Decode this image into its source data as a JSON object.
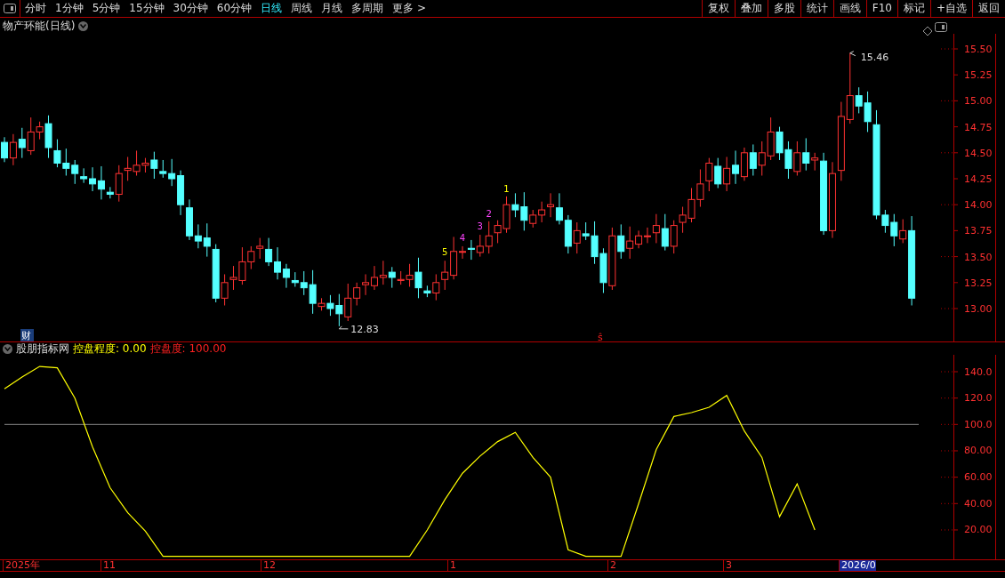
{
  "toolbar": {
    "periods": [
      {
        "label": "分时",
        "selected": false
      },
      {
        "label": "1分钟",
        "selected": false
      },
      {
        "label": "5分钟",
        "selected": false
      },
      {
        "label": "15分钟",
        "selected": false
      },
      {
        "label": "30分钟",
        "selected": false
      },
      {
        "label": "60分钟",
        "selected": false
      },
      {
        "label": "日线",
        "selected": true
      },
      {
        "label": "周线",
        "selected": false
      },
      {
        "label": "月线",
        "selected": false
      },
      {
        "label": "多周期",
        "selected": false
      }
    ],
    "more": "更多 >",
    "buttons": [
      "复权",
      "叠加",
      "多股",
      "统计",
      "画线",
      "F10",
      "标记",
      "+自选",
      "返回"
    ]
  },
  "price_panel": {
    "title": "物产环能(日线)",
    "axis_labels": [
      "15.50",
      "15.25",
      "15.00",
      "14.75",
      "14.50",
      "14.25",
      "14.00",
      "13.75",
      "13.50",
      "13.25",
      "13.00"
    ],
    "high_label": "15.46",
    "low_label": "12.83",
    "badge": "财",
    "sell_mark": "ŝ",
    "signals": [
      {
        "text": "1",
        "color": "#ffff00"
      },
      {
        "text": "2",
        "color": "#ff44ff"
      },
      {
        "text": "3",
        "color": "#ff44ff"
      },
      {
        "text": "4",
        "color": "#ff44ff"
      },
      {
        "text": "5",
        "color": "#ffff00"
      }
    ]
  },
  "indicator_panel": {
    "name": "股朋指标网",
    "fields": [
      {
        "label": "控盘程度:",
        "value": "0.00",
        "color": "#ffff00"
      },
      {
        "label": "控盘度:",
        "value": "100.00",
        "color": "#ff2020"
      }
    ],
    "axis_labels": [
      "140.0",
      "120.0",
      "100.0",
      "80.00",
      "60.00",
      "40.00",
      "20.00"
    ]
  },
  "date_axis": [
    {
      "label": "2025年",
      "highlighted": false
    },
    {
      "label": "11",
      "highlighted": false
    },
    {
      "label": "12",
      "highlighted": false
    },
    {
      "label": "1",
      "highlighted": false
    },
    {
      "label": "2",
      "highlighted": false
    },
    {
      "label": "3",
      "highlighted": false
    },
    {
      "label": "2026/0",
      "highlighted": true
    }
  ]
}
